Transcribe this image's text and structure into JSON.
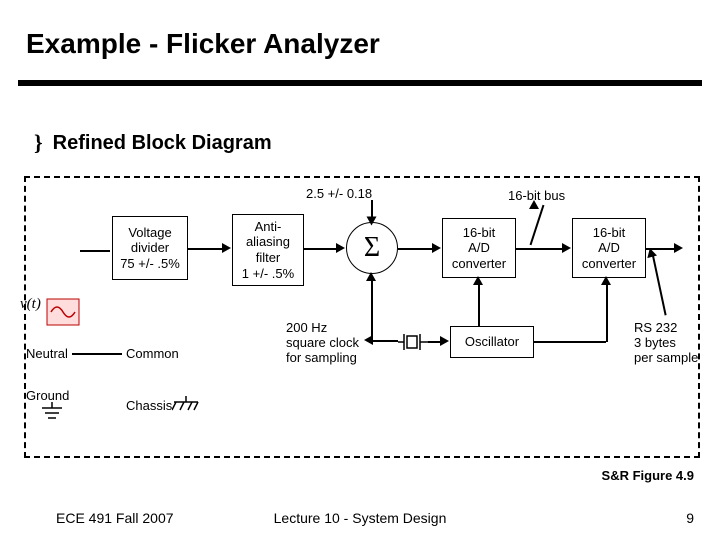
{
  "slide": {
    "title": "Example - Flicker Analyzer",
    "bullet": "Refined Block Diagram"
  },
  "diagram": {
    "top_label": "2.5 +/- 0.18",
    "bus_label": "16-bit bus",
    "blocks": {
      "voltage_divider": "Voltage\ndivider\n75 +/- .5%",
      "anti_aliasing": "Anti-\naliasing\nfilter\n1 +/- .5%",
      "adc1": "16-bit\nA/D\nconverter",
      "adc2": "16-bit\nA/D\nconverter",
      "sigma": "Σ",
      "clock": "200 Hz\nsquare clock\nfor sampling",
      "oscillator": "Oscillator"
    },
    "io": {
      "vt": "v(t)",
      "neutral": "Neutral",
      "ground": "Ground",
      "common": "Common",
      "chassis": "Chassis"
    },
    "rs232": "RS 232\n3 bytes\nper sample"
  },
  "footer": {
    "left": "ECE 491 Fall 2007",
    "center": "Lecture 10 - System Design",
    "right": "9"
  },
  "citation": "S&R Figure 4.9"
}
